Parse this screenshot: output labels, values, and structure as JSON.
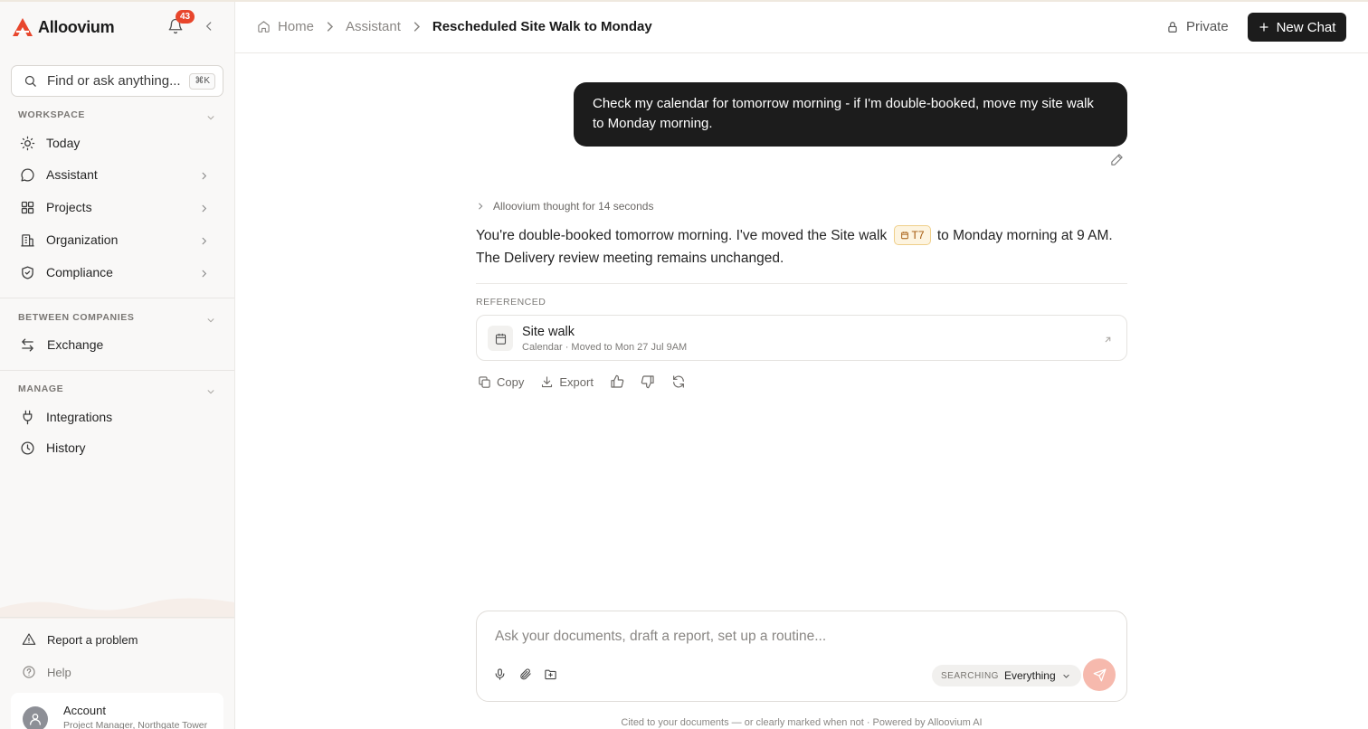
{
  "app": {
    "name": "Alloovium",
    "notification_count": "43",
    "accent": "#e8462c"
  },
  "search": {
    "placeholder": "Find or ask anything...",
    "shortcut": "⌘K"
  },
  "sidebar": {
    "workspace_label": "WORKSPACE",
    "workspace_items": [
      {
        "label": "Today",
        "icon": "sun-icon"
      },
      {
        "label": "Assistant",
        "icon": "chat-bubble-icon"
      },
      {
        "label": "Projects",
        "icon": "grid-icon"
      },
      {
        "label": "Organization",
        "icon": "building-icon"
      },
      {
        "label": "Compliance",
        "icon": "shield-check-icon"
      }
    ],
    "between_label": "BETWEEN COMPANIES",
    "between_items": [
      {
        "label": "Exchange",
        "icon": "arrows-swap-icon"
      }
    ],
    "manage_label": "MANAGE",
    "manage_items": [
      {
        "label": "Integrations",
        "icon": "plug-icon"
      },
      {
        "label": "History",
        "icon": "clock-icon"
      }
    ],
    "report_label": "Report a problem",
    "help_label": "Help",
    "account": {
      "name": "Account",
      "subtitle": "Project Manager, Northgate Tower"
    }
  },
  "header": {
    "breadcrumb": [
      "Home",
      "Assistant",
      "Rescheduled Site Walk to Monday"
    ],
    "privacy": "Private",
    "new_chat": "New Chat"
  },
  "chat": {
    "user_message": "Check my calendar for tomorrow morning - if I'm double-booked, move my site walk to Monday morning.",
    "thought": "Alloovium thought for 14 seconds",
    "reply_part1": "You're double-booked tomorrow morning. I've moved the Site walk",
    "reply_chip": "T7",
    "reply_part2": "to Monday morning at 9 AM. The Delivery review meeting remains unchanged.",
    "referenced_label": "REFERENCED",
    "reference": {
      "title": "Site walk",
      "subtitle": "Calendar · Moved to Mon 27 Jul 9AM"
    },
    "actions": {
      "copy": "Copy",
      "export": "Export"
    }
  },
  "composer": {
    "placeholder": "Ask your documents, draft a report, set up a routine...",
    "searching_label": "SEARCHING",
    "scope_value": "Everything"
  },
  "footer": "Cited to your documents — or clearly marked when not · Powered by Alloovium AI"
}
